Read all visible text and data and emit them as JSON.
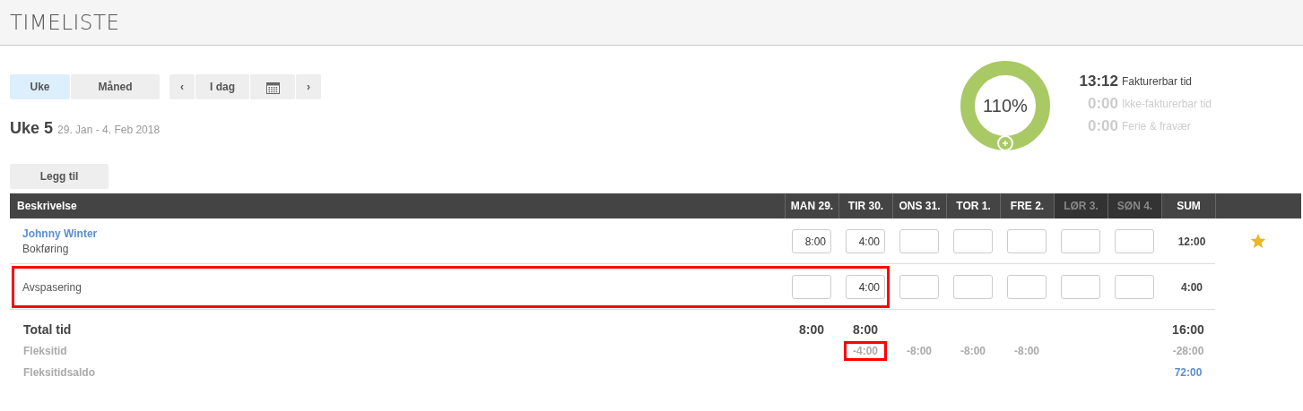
{
  "page": {
    "title": "TIMELISTE"
  },
  "view_tabs": [
    {
      "label": "Uke",
      "selected": true
    },
    {
      "label": "Måned",
      "selected": false
    }
  ],
  "navigation": {
    "prev": "‹",
    "today": "I dag",
    "next": "›"
  },
  "period": {
    "title": "Uke 5",
    "range": "29. Jan - 4. Feb 2018"
  },
  "add_button": "Legg til",
  "summary": {
    "percent": "110%",
    "items": [
      {
        "value": "13:12",
        "label": "Fakturerbar tid",
        "active": true
      },
      {
        "value": "0:00",
        "label": "Ikke-fakturerbar tid",
        "active": false
      },
      {
        "value": "0:00",
        "label": "Ferie & fravær",
        "active": false
      }
    ]
  },
  "table": {
    "columns": [
      {
        "label": "Beskrivelse",
        "weekend": false
      },
      {
        "label": "MAN 29.",
        "weekend": false
      },
      {
        "label": "TIR 30.",
        "weekend": false
      },
      {
        "label": "ONS 31.",
        "weekend": false
      },
      {
        "label": "TOR 1.",
        "weekend": false
      },
      {
        "label": "FRE 2.",
        "weekend": false
      },
      {
        "label": "LØR 3.",
        "weekend": true
      },
      {
        "label": "SØN 4.",
        "weekend": true
      },
      {
        "label": "SUM",
        "weekend": false
      }
    ],
    "rows": [
      {
        "title": "Johnny Winter",
        "subtitle": "Bokføring",
        "hours": [
          {
            "kind": "input",
            "value": "8:00"
          },
          {
            "kind": "input",
            "value": "4:00"
          },
          {
            "kind": "input"
          },
          {
            "kind": "input"
          },
          {
            "kind": "input"
          },
          {
            "kind": "input"
          },
          {
            "kind": "input"
          }
        ],
        "sum": "12:00",
        "starred": true,
        "highlighted": false
      },
      {
        "subtitle": "Avspasering",
        "hours": [
          {
            "kind": "input"
          },
          {
            "kind": "input",
            "value": "4:00"
          },
          {
            "kind": "input"
          },
          {
            "kind": "input"
          },
          {
            "kind": "input"
          },
          {
            "kind": "input"
          },
          {
            "kind": "input"
          }
        ],
        "sum": "4:00",
        "starred": false,
        "highlighted": true
      }
    ],
    "totals": [
      {
        "kind": "total",
        "label": "Total tid",
        "cells": [
          {
            "kind": "value",
            "text": "8:00",
            "highlighted": false
          },
          {
            "kind": "value",
            "text": "8:00",
            "highlighted": false
          },
          {
            "kind": "blank"
          },
          {
            "kind": "blank"
          },
          {
            "kind": "blank"
          },
          {
            "kind": "blank"
          },
          {
            "kind": "blank"
          }
        ],
        "sum": "16:00"
      },
      {
        "kind": "flex",
        "label": "Fleksitid",
        "cells": [
          {
            "kind": "blank"
          },
          {
            "kind": "value",
            "text": "-4:00",
            "highlighted": true
          },
          {
            "kind": "value",
            "text": "-8:00",
            "highlighted": false
          },
          {
            "kind": "value",
            "text": "-8:00",
            "highlighted": false
          },
          {
            "kind": "value",
            "text": "-8:00",
            "highlighted": false
          },
          {
            "kind": "blank"
          },
          {
            "kind": "blank"
          }
        ],
        "sum": "-28:00"
      },
      {
        "kind": "balance",
        "label": "Fleksitidsaldo",
        "cells": [
          {
            "kind": "blank"
          },
          {
            "kind": "blank"
          },
          {
            "kind": "blank"
          },
          {
            "kind": "blank"
          },
          {
            "kind": "blank"
          },
          {
            "kind": "blank"
          },
          {
            "kind": "blank"
          }
        ],
        "sum": "72:00"
      }
    ]
  }
}
